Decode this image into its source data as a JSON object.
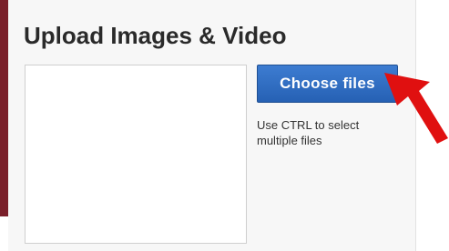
{
  "panel": {
    "title": "Upload Images & Video",
    "choose_button_label": "Choose files",
    "hint_text": "Use CTRL to select multiple files"
  },
  "colors": {
    "accent_border": "#7a1f2a",
    "button_blue": "#2a67bb",
    "arrow_red": "#e01010"
  },
  "icons": {
    "annotation": "red-arrow-icon"
  }
}
